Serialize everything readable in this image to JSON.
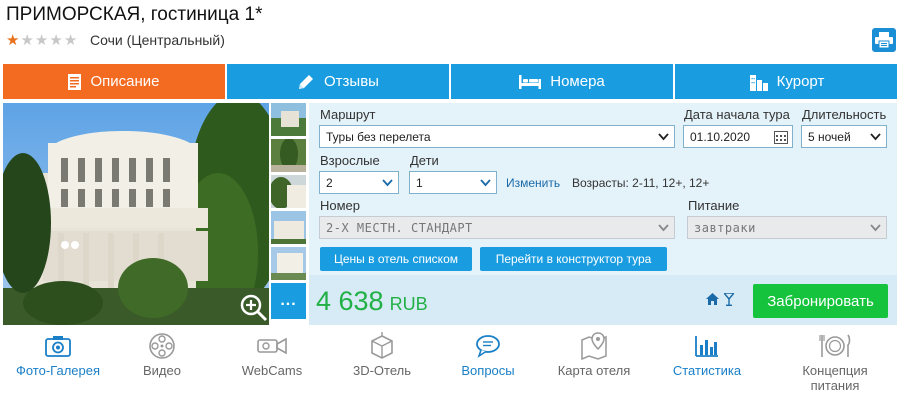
{
  "hotel": {
    "title": "ПРИМОРСКАЯ, гостиница 1*",
    "rating": 1,
    "max_rating": 5,
    "location": "Сочи (Центральный)"
  },
  "icons": {
    "print": "printer-icon",
    "zoom": "zoom-in-icon"
  },
  "tabs": [
    {
      "label": "Описание",
      "icon": "document-icon",
      "active": true
    },
    {
      "label": "Отзывы",
      "icon": "pencil-icon",
      "active": false
    },
    {
      "label": "Номера",
      "icon": "bed-icon",
      "active": false
    },
    {
      "label": "Курорт",
      "icon": "buildings-icon",
      "active": false
    }
  ],
  "gallery": {
    "more_label": "..."
  },
  "form": {
    "route_label": "Маршрут",
    "route_value": "Туры без перелета",
    "date_label": "Дата начала тура",
    "date_value": "01.10.2020",
    "duration_label": "Длительность",
    "duration_value": "5 ночей",
    "adults_label": "Взрослые",
    "adults_value": "2",
    "children_label": "Дети",
    "children_value": "1",
    "change_link": "Изменить",
    "ages_text": "Возрасты: 2-11, 12+, 12+",
    "room_label": "Номер",
    "room_value": "2-Х МЕСТН. СТАНДАРТ",
    "meal_label": "Питание",
    "meal_value": "завтраки",
    "btn_prices": "Цены в отель списком",
    "btn_constructor": "Перейти в конструктор тура",
    "price": "4 638",
    "currency": "RUB",
    "book_label": "Забронировать"
  },
  "bottom_nav": [
    {
      "label": "Фото-Галерея",
      "icon": "camera-icon",
      "active": true
    },
    {
      "label": "Видео",
      "icon": "film-reel-icon",
      "active": false
    },
    {
      "label": "WebCams",
      "icon": "webcam-icon",
      "active": false
    },
    {
      "label": "3D-Отель",
      "icon": "cube-3d-icon",
      "active": false
    },
    {
      "label": "Вопросы",
      "icon": "chat-bubble-icon",
      "active": true
    },
    {
      "label": "Карта отеля",
      "icon": "map-pin-icon",
      "active": false
    },
    {
      "label": "Статистика",
      "icon": "bar-chart-icon",
      "active": true
    },
    {
      "label": "Концепция питания",
      "icon": "plate-cutlery-icon",
      "active": false
    }
  ],
  "colors": {
    "accent_blue": "#1a9de0",
    "active_tab": "#f36a21",
    "price_green": "#21b045",
    "book_green": "#15c33c",
    "star_on": "#e9721f"
  }
}
